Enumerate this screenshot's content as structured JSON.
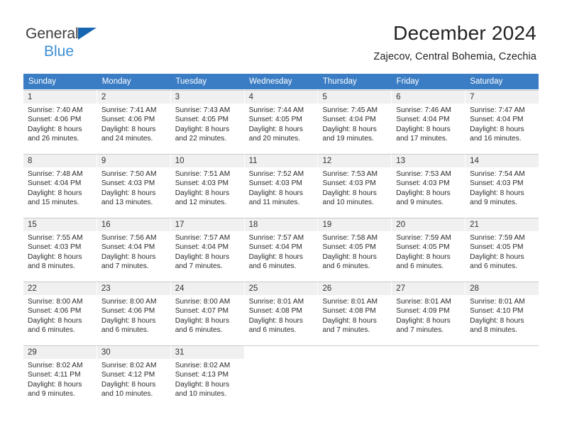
{
  "brand": {
    "name_part1": "General",
    "name_part2": "Blue",
    "triangle_color": "#1565b0",
    "blue_text_color": "#3a8fd4"
  },
  "header": {
    "title": "December 2024",
    "subtitle": "Zajecov, Central Bohemia, Czechia"
  },
  "theme": {
    "header_blue": "#3b7dc4",
    "date_band": "#f0f0f0",
    "grid_line": "#c9c9c9",
    "text": "#2b2b2b"
  },
  "weekday_headers": [
    "Sunday",
    "Monday",
    "Tuesday",
    "Wednesday",
    "Thursday",
    "Friday",
    "Saturday"
  ],
  "weeks": [
    [
      {
        "date": "1",
        "sunrise": "Sunrise: 7:40 AM",
        "sunset": "Sunset: 4:06 PM",
        "daylight_line1": "Daylight: 8 hours",
        "daylight_line2": "and 26 minutes."
      },
      {
        "date": "2",
        "sunrise": "Sunrise: 7:41 AM",
        "sunset": "Sunset: 4:06 PM",
        "daylight_line1": "Daylight: 8 hours",
        "daylight_line2": "and 24 minutes."
      },
      {
        "date": "3",
        "sunrise": "Sunrise: 7:43 AM",
        "sunset": "Sunset: 4:05 PM",
        "daylight_line1": "Daylight: 8 hours",
        "daylight_line2": "and 22 minutes."
      },
      {
        "date": "4",
        "sunrise": "Sunrise: 7:44 AM",
        "sunset": "Sunset: 4:05 PM",
        "daylight_line1": "Daylight: 8 hours",
        "daylight_line2": "and 20 minutes."
      },
      {
        "date": "5",
        "sunrise": "Sunrise: 7:45 AM",
        "sunset": "Sunset: 4:04 PM",
        "daylight_line1": "Daylight: 8 hours",
        "daylight_line2": "and 19 minutes."
      },
      {
        "date": "6",
        "sunrise": "Sunrise: 7:46 AM",
        "sunset": "Sunset: 4:04 PM",
        "daylight_line1": "Daylight: 8 hours",
        "daylight_line2": "and 17 minutes."
      },
      {
        "date": "7",
        "sunrise": "Sunrise: 7:47 AM",
        "sunset": "Sunset: 4:04 PM",
        "daylight_line1": "Daylight: 8 hours",
        "daylight_line2": "and 16 minutes."
      }
    ],
    [
      {
        "date": "8",
        "sunrise": "Sunrise: 7:48 AM",
        "sunset": "Sunset: 4:04 PM",
        "daylight_line1": "Daylight: 8 hours",
        "daylight_line2": "and 15 minutes."
      },
      {
        "date": "9",
        "sunrise": "Sunrise: 7:50 AM",
        "sunset": "Sunset: 4:03 PM",
        "daylight_line1": "Daylight: 8 hours",
        "daylight_line2": "and 13 minutes."
      },
      {
        "date": "10",
        "sunrise": "Sunrise: 7:51 AM",
        "sunset": "Sunset: 4:03 PM",
        "daylight_line1": "Daylight: 8 hours",
        "daylight_line2": "and 12 minutes."
      },
      {
        "date": "11",
        "sunrise": "Sunrise: 7:52 AM",
        "sunset": "Sunset: 4:03 PM",
        "daylight_line1": "Daylight: 8 hours",
        "daylight_line2": "and 11 minutes."
      },
      {
        "date": "12",
        "sunrise": "Sunrise: 7:53 AM",
        "sunset": "Sunset: 4:03 PM",
        "daylight_line1": "Daylight: 8 hours",
        "daylight_line2": "and 10 minutes."
      },
      {
        "date": "13",
        "sunrise": "Sunrise: 7:53 AM",
        "sunset": "Sunset: 4:03 PM",
        "daylight_line1": "Daylight: 8 hours",
        "daylight_line2": "and 9 minutes."
      },
      {
        "date": "14",
        "sunrise": "Sunrise: 7:54 AM",
        "sunset": "Sunset: 4:03 PM",
        "daylight_line1": "Daylight: 8 hours",
        "daylight_line2": "and 9 minutes."
      }
    ],
    [
      {
        "date": "15",
        "sunrise": "Sunrise: 7:55 AM",
        "sunset": "Sunset: 4:03 PM",
        "daylight_line1": "Daylight: 8 hours",
        "daylight_line2": "and 8 minutes."
      },
      {
        "date": "16",
        "sunrise": "Sunrise: 7:56 AM",
        "sunset": "Sunset: 4:04 PM",
        "daylight_line1": "Daylight: 8 hours",
        "daylight_line2": "and 7 minutes."
      },
      {
        "date": "17",
        "sunrise": "Sunrise: 7:57 AM",
        "sunset": "Sunset: 4:04 PM",
        "daylight_line1": "Daylight: 8 hours",
        "daylight_line2": "and 7 minutes."
      },
      {
        "date": "18",
        "sunrise": "Sunrise: 7:57 AM",
        "sunset": "Sunset: 4:04 PM",
        "daylight_line1": "Daylight: 8 hours",
        "daylight_line2": "and 6 minutes."
      },
      {
        "date": "19",
        "sunrise": "Sunrise: 7:58 AM",
        "sunset": "Sunset: 4:05 PM",
        "daylight_line1": "Daylight: 8 hours",
        "daylight_line2": "and 6 minutes."
      },
      {
        "date": "20",
        "sunrise": "Sunrise: 7:59 AM",
        "sunset": "Sunset: 4:05 PM",
        "daylight_line1": "Daylight: 8 hours",
        "daylight_line2": "and 6 minutes."
      },
      {
        "date": "21",
        "sunrise": "Sunrise: 7:59 AM",
        "sunset": "Sunset: 4:05 PM",
        "daylight_line1": "Daylight: 8 hours",
        "daylight_line2": "and 6 minutes."
      }
    ],
    [
      {
        "date": "22",
        "sunrise": "Sunrise: 8:00 AM",
        "sunset": "Sunset: 4:06 PM",
        "daylight_line1": "Daylight: 8 hours",
        "daylight_line2": "and 6 minutes."
      },
      {
        "date": "23",
        "sunrise": "Sunrise: 8:00 AM",
        "sunset": "Sunset: 4:06 PM",
        "daylight_line1": "Daylight: 8 hours",
        "daylight_line2": "and 6 minutes."
      },
      {
        "date": "24",
        "sunrise": "Sunrise: 8:00 AM",
        "sunset": "Sunset: 4:07 PM",
        "daylight_line1": "Daylight: 8 hours",
        "daylight_line2": "and 6 minutes."
      },
      {
        "date": "25",
        "sunrise": "Sunrise: 8:01 AM",
        "sunset": "Sunset: 4:08 PM",
        "daylight_line1": "Daylight: 8 hours",
        "daylight_line2": "and 6 minutes."
      },
      {
        "date": "26",
        "sunrise": "Sunrise: 8:01 AM",
        "sunset": "Sunset: 4:08 PM",
        "daylight_line1": "Daylight: 8 hours",
        "daylight_line2": "and 7 minutes."
      },
      {
        "date": "27",
        "sunrise": "Sunrise: 8:01 AM",
        "sunset": "Sunset: 4:09 PM",
        "daylight_line1": "Daylight: 8 hours",
        "daylight_line2": "and 7 minutes."
      },
      {
        "date": "28",
        "sunrise": "Sunrise: 8:01 AM",
        "sunset": "Sunset: 4:10 PM",
        "daylight_line1": "Daylight: 8 hours",
        "daylight_line2": "and 8 minutes."
      }
    ],
    [
      {
        "date": "29",
        "sunrise": "Sunrise: 8:02 AM",
        "sunset": "Sunset: 4:11 PM",
        "daylight_line1": "Daylight: 8 hours",
        "daylight_line2": "and 9 minutes."
      },
      {
        "date": "30",
        "sunrise": "Sunrise: 8:02 AM",
        "sunset": "Sunset: 4:12 PM",
        "daylight_line1": "Daylight: 8 hours",
        "daylight_line2": "and 10 minutes."
      },
      {
        "date": "31",
        "sunrise": "Sunrise: 8:02 AM",
        "sunset": "Sunset: 4:13 PM",
        "daylight_line1": "Daylight: 8 hours",
        "daylight_line2": "and 10 minutes."
      },
      {
        "date": "",
        "sunrise": "",
        "sunset": "",
        "daylight_line1": "",
        "daylight_line2": ""
      },
      {
        "date": "",
        "sunrise": "",
        "sunset": "",
        "daylight_line1": "",
        "daylight_line2": ""
      },
      {
        "date": "",
        "sunrise": "",
        "sunset": "",
        "daylight_line1": "",
        "daylight_line2": ""
      },
      {
        "date": "",
        "sunrise": "",
        "sunset": "",
        "daylight_line1": "",
        "daylight_line2": ""
      }
    ]
  ]
}
